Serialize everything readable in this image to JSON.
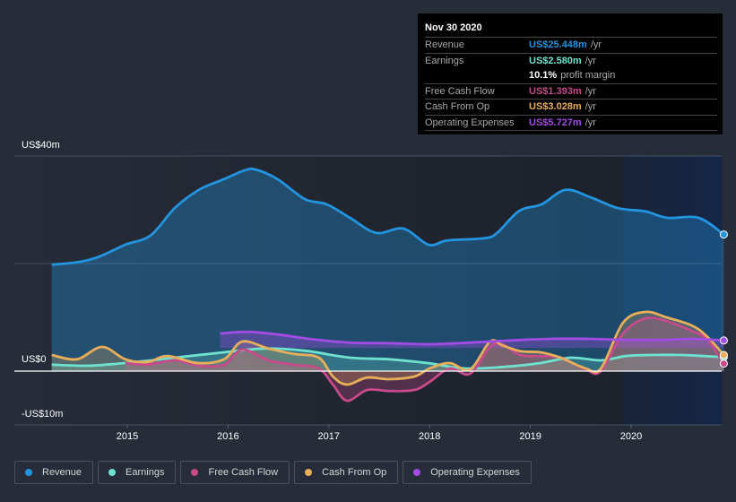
{
  "colors": {
    "revenue": "#2394df",
    "earnings": "#6ee2cf",
    "free_cash_flow": "#c74a8a",
    "cash_from_op": "#e8ae5a",
    "operating_expenses": "#a24ce6"
  },
  "tooltip": {
    "date": "Nov 30 2020",
    "rows": [
      {
        "label": "Revenue",
        "value": "US$25.448m",
        "unit": "/yr"
      },
      {
        "label": "Earnings",
        "value": "US$2.580m",
        "unit": "/yr"
      },
      {
        "label": "",
        "value": "10.1%",
        "unit": "profit margin"
      },
      {
        "label": "Free Cash Flow",
        "value": "US$1.393m",
        "unit": "/yr"
      },
      {
        "label": "Cash From Op",
        "value": "US$3.028m",
        "unit": "/yr"
      },
      {
        "label": "Operating Expenses",
        "value": "US$5.727m",
        "unit": "/yr"
      }
    ]
  },
  "legend": [
    {
      "label": "Revenue",
      "key": "revenue"
    },
    {
      "label": "Earnings",
      "key": "earnings"
    },
    {
      "label": "Free Cash Flow",
      "key": "free_cash_flow"
    },
    {
      "label": "Cash From Op",
      "key": "cash_from_op"
    },
    {
      "label": "Operating Expenses",
      "key": "operating_expenses"
    }
  ],
  "chart_data": {
    "type": "area",
    "title": "",
    "xlabel": "",
    "ylabel": "",
    "y_tick_labels": [
      "US$40m",
      "US$0",
      "-US$10m"
    ],
    "y_ticks": [
      40,
      0,
      -10
    ],
    "ylim": [
      -10,
      40
    ],
    "xlim": [
      2014.2,
      2020.92
    ],
    "x_tick_labels": [
      "2015",
      "2016",
      "2017",
      "2018",
      "2019",
      "2020"
    ],
    "x_ticks": [
      2015,
      2016,
      2017,
      2018,
      2019,
      2020
    ],
    "highlight_range": [
      2019.92,
      2020.92
    ],
    "grid": true,
    "legend_position": "bottom",
    "series": [
      {
        "name": "Revenue",
        "key": "revenue",
        "x": [
          2014.25,
          2014.49,
          2014.71,
          2014.98,
          2015.23,
          2015.47,
          2015.71,
          2015.96,
          2016.16,
          2016.27,
          2016.49,
          2016.76,
          2016.98,
          2017.21,
          2017.47,
          2017.74,
          2017.99,
          2018.18,
          2018.54,
          2018.67,
          2018.89,
          2019.11,
          2019.35,
          2019.6,
          2019.87,
          2020.14,
          2020.36,
          2020.67,
          2020.92
        ],
        "values": [
          19.8,
          20.2,
          21.2,
          23.5,
          25.2,
          30.3,
          33.7,
          35.7,
          37.3,
          37.5,
          35.7,
          32.0,
          31.0,
          28.5,
          25.7,
          26.5,
          23.5,
          24.3,
          24.7,
          25.7,
          29.8,
          31.0,
          33.7,
          32.3,
          30.3,
          29.7,
          28.5,
          28.5,
          25.4
        ]
      },
      {
        "name": "Earnings",
        "key": "earnings",
        "x": [
          2014.25,
          2014.6,
          2014.98,
          2015.47,
          2015.96,
          2016.36,
          2016.76,
          2017.21,
          2017.6,
          2017.98,
          2018.35,
          2018.75,
          2019.1,
          2019.4,
          2019.7,
          2019.95,
          2020.2,
          2020.5,
          2020.92
        ],
        "values": [
          1.2,
          1.0,
          1.5,
          2.5,
          3.5,
          4.2,
          3.8,
          2.5,
          2.2,
          1.5,
          0.5,
          0.8,
          1.5,
          2.5,
          2.0,
          2.8,
          3.0,
          3.0,
          2.6
        ]
      },
      {
        "name": "Free Cash Flow",
        "key": "free_cash_flow",
        "x": [
          2014.98,
          2015.2,
          2015.47,
          2015.71,
          2015.96,
          2016.14,
          2016.4,
          2016.65,
          2016.9,
          2017.04,
          2017.18,
          2017.38,
          2017.6,
          2017.85,
          2018.0,
          2018.2,
          2018.4,
          2018.6,
          2018.72,
          2018.9,
          2019.1,
          2019.3,
          2019.55,
          2019.7,
          2019.92,
          2020.14,
          2020.35,
          2020.6,
          2020.75,
          2020.92
        ],
        "values": [
          1.5,
          1.2,
          2.0,
          1.0,
          1.2,
          4.0,
          2.0,
          1.2,
          0.5,
          -2.5,
          -5.5,
          -3.5,
          -3.7,
          -3.5,
          -2.0,
          0.5,
          -0.5,
          4.5,
          5.0,
          3.0,
          2.8,
          2.5,
          0.3,
          0,
          7.0,
          9.8,
          9.3,
          7.5,
          6.0,
          1.4
        ]
      },
      {
        "name": "Cash From Op",
        "key": "cash_from_op",
        "x": [
          2014.25,
          2014.5,
          2014.75,
          2014.98,
          2015.2,
          2015.4,
          2015.7,
          2015.96,
          2016.14,
          2016.4,
          2016.65,
          2016.9,
          2017.04,
          2017.18,
          2017.38,
          2017.6,
          2017.85,
          2018.0,
          2018.2,
          2018.4,
          2018.6,
          2018.72,
          2018.9,
          2019.1,
          2019.3,
          2019.55,
          2019.7,
          2019.92,
          2020.14,
          2020.35,
          2020.6,
          2020.75,
          2020.92
        ],
        "values": [
          3.0,
          2.2,
          4.5,
          2.2,
          1.7,
          2.8,
          1.5,
          2.2,
          5.5,
          4.2,
          3.2,
          2.5,
          -1.0,
          -2.5,
          -1.2,
          -1.5,
          -1.0,
          0.5,
          1.5,
          0.3,
          5.5,
          4.8,
          3.7,
          3.5,
          2.5,
          0.5,
          0.5,
          9.0,
          11.0,
          10.0,
          8.5,
          6.5,
          3.0
        ]
      },
      {
        "name": "Operating Expenses",
        "key": "operating_expenses",
        "x": [
          2015.92,
          2016.2,
          2016.5,
          2016.8,
          2017.2,
          2017.6,
          2018.0,
          2018.4,
          2018.8,
          2019.2,
          2019.6,
          2019.95,
          2020.3,
          2020.6,
          2020.92
        ],
        "values": [
          7.0,
          7.3,
          6.8,
          6.0,
          5.3,
          5.2,
          5.0,
          5.3,
          5.7,
          6.0,
          6.0,
          5.8,
          5.8,
          6.0,
          5.7
        ]
      }
    ]
  }
}
